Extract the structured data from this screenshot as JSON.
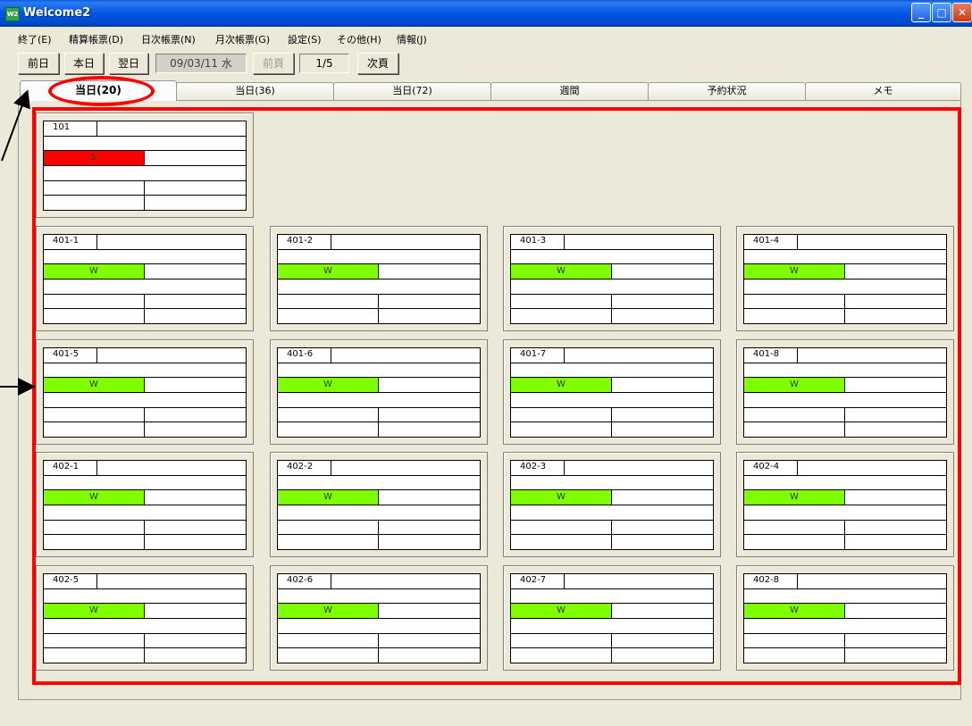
{
  "window": {
    "title": "Welcome2",
    "icon": "app-icon",
    "controls": [
      "minimize-icon",
      "maximize-icon",
      "close-icon"
    ]
  },
  "menu": [
    "終了(E)",
    "精算帳票(D)",
    "日次帳票(N)",
    "月次帳票(G)",
    "設定(S)",
    "その他(H)",
    "情報(J)"
  ],
  "toolbar": {
    "prev_day": "前日",
    "today": "本日",
    "next_day": "翌日",
    "date": "09/03/11 水",
    "prev_page": "前頁",
    "page": "1/5",
    "next_page": "次頁"
  },
  "tabs": [
    "当日(20)",
    "当日(36)",
    "当日(72)",
    "週間",
    "予約状況",
    "メモ"
  ],
  "colors": {
    "vacant": "#80ff00",
    "stay": "#ff0000",
    "annotation": "#ff0000"
  },
  "rooms": [
    {
      "number": "101",
      "status": "S",
      "color": "#ff0000"
    },
    {
      "number": "401-1",
      "status": "W",
      "color": "#80ff00"
    },
    {
      "number": "401-2",
      "status": "W",
      "color": "#80ff00"
    },
    {
      "number": "401-3",
      "status": "W",
      "color": "#80ff00"
    },
    {
      "number": "401-4",
      "status": "W",
      "color": "#80ff00"
    },
    {
      "number": "401-5",
      "status": "W",
      "color": "#80ff00"
    },
    {
      "number": "401-6",
      "status": "W",
      "color": "#80ff00"
    },
    {
      "number": "401-7",
      "status": "W",
      "color": "#80ff00"
    },
    {
      "number": "401-8",
      "status": "W",
      "color": "#80ff00"
    },
    {
      "number": "402-1",
      "status": "W",
      "color": "#80ff00"
    },
    {
      "number": "402-2",
      "status": "W",
      "color": "#80ff00"
    },
    {
      "number": "402-3",
      "status": "W",
      "color": "#80ff00"
    },
    {
      "number": "402-4",
      "status": "W",
      "color": "#80ff00"
    },
    {
      "number": "402-5",
      "status": "W",
      "color": "#80ff00"
    },
    {
      "number": "402-6",
      "status": "W",
      "color": "#80ff00"
    },
    {
      "number": "402-7",
      "status": "W",
      "color": "#80ff00"
    },
    {
      "number": "402-8",
      "status": "W",
      "color": "#80ff00"
    }
  ]
}
